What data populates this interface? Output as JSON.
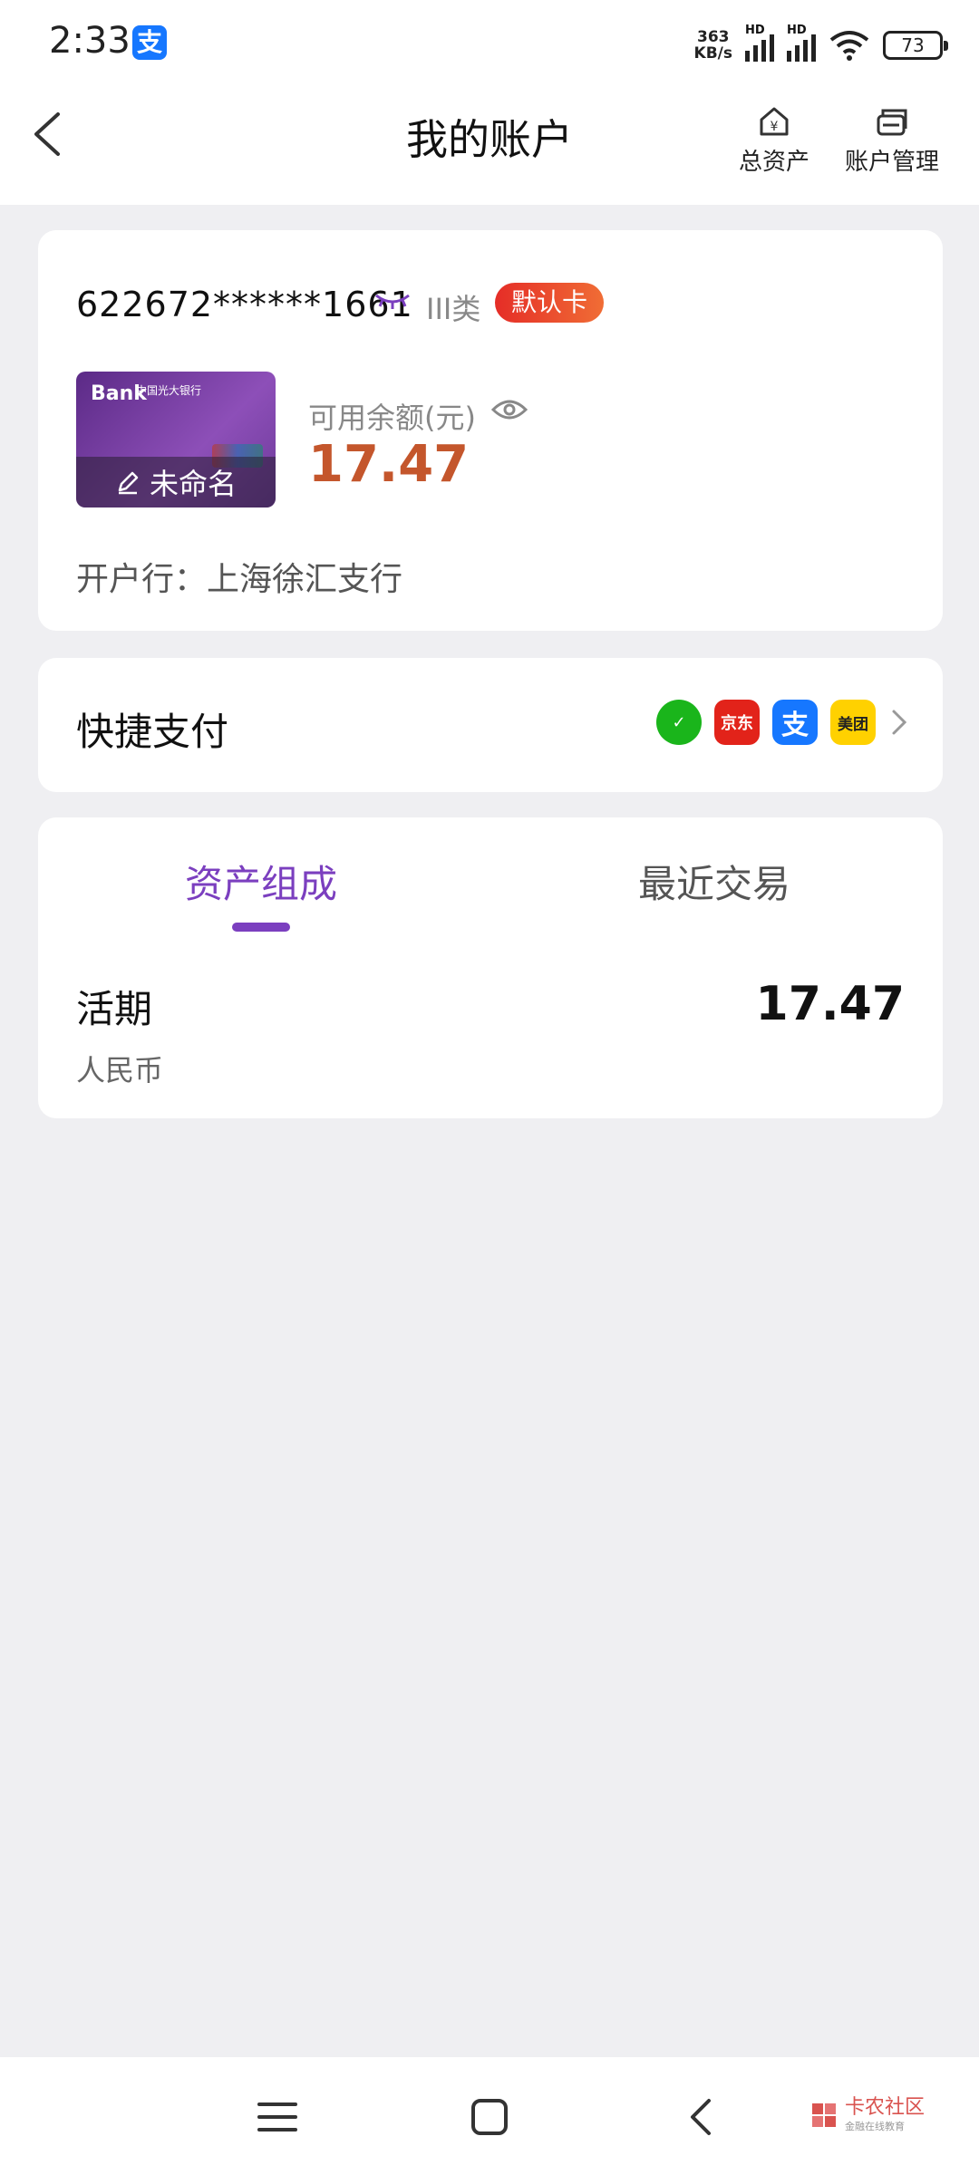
{
  "status": {
    "time": "2:33",
    "net_speed": "363",
    "net_unit": "KB/s",
    "signal_label": "HD",
    "battery": "73",
    "app_icon_glyph": "支"
  },
  "header": {
    "title": "我的账户",
    "actions": [
      {
        "label": "总资产",
        "icon": "house-yen-icon"
      },
      {
        "label": "账户管理",
        "icon": "card-manage-icon"
      }
    ]
  },
  "account": {
    "number": "622672******1661",
    "class": "III类",
    "default_badge": "默认卡",
    "card_bank_mark": "Bank",
    "card_bank_cn": "中国光大银行",
    "card_name": "未命名",
    "balance_label": "可用余额(元)",
    "balance": "17.47",
    "branch": "开户行：上海徐汇支行"
  },
  "quickpay": {
    "label": "快捷支付",
    "icons": [
      {
        "name": "wechat-pay-icon",
        "glyph": "✓"
      },
      {
        "name": "jd-pay-icon",
        "glyph": "京东"
      },
      {
        "name": "alipay-icon",
        "glyph": "支"
      },
      {
        "name": "meituan-pay-icon",
        "glyph": "美团"
      }
    ]
  },
  "assets": {
    "tabs": [
      "资产组成",
      "最近交易"
    ],
    "active_tab": 0,
    "items": [
      {
        "name": "活期",
        "currency": "人民币",
        "value": "17.47"
      }
    ]
  },
  "watermark": {
    "title": "卡农社区",
    "subtitle": "金融在线教育"
  },
  "colors": {
    "accent": "#7b3fbf",
    "balance": "#c4562c",
    "badge": "#e52d27"
  }
}
